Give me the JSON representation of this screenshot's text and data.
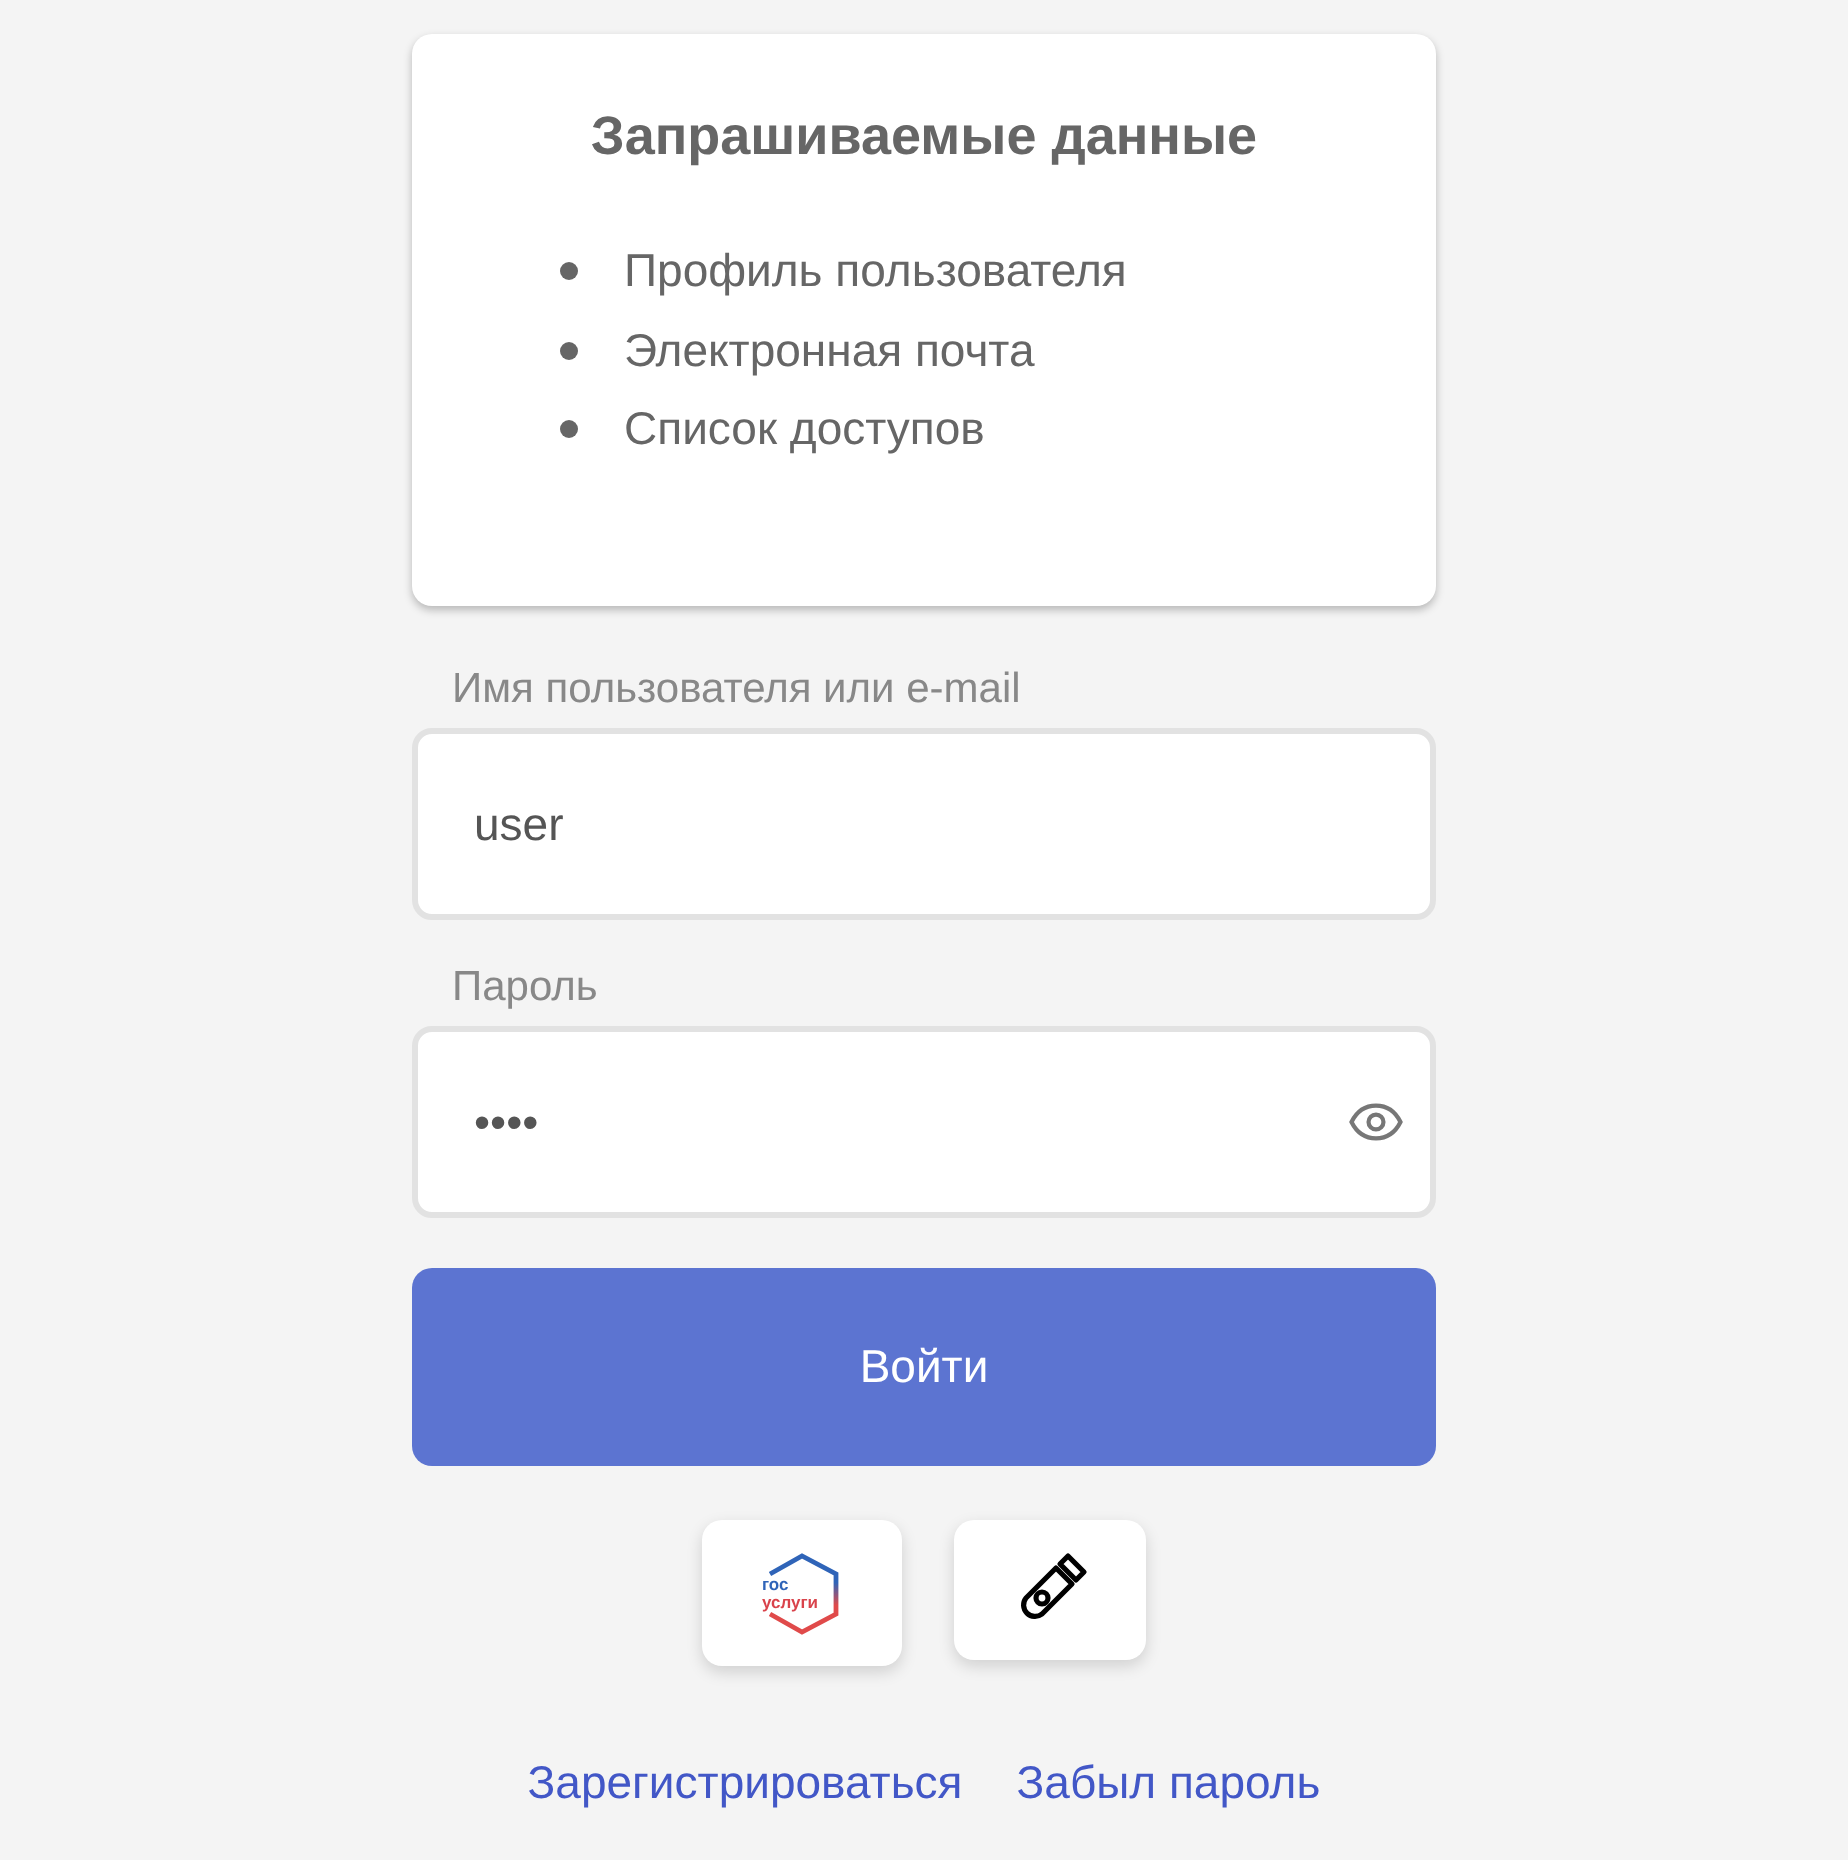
{
  "scopes": {
    "title": "Запрашиваемые данные",
    "items": [
      "Профиль пользователя",
      "Электронная почта",
      "Список доступов"
    ]
  },
  "fields": [
    {
      "kind": "text",
      "label": "Имя пользователя или e-mail",
      "value": "user"
    },
    {
      "kind": "password",
      "label": "Пароль",
      "value": "••••"
    }
  ],
  "submit": "Войти",
  "alt_logins": [
    {
      "kind": "gov",
      "logo_lines": [
        "гос",
        "услуги"
      ]
    },
    {
      "kind": "usb_key"
    }
  ],
  "links": [
    "Зарегистрироваться",
    "Забыл пароль"
  ]
}
